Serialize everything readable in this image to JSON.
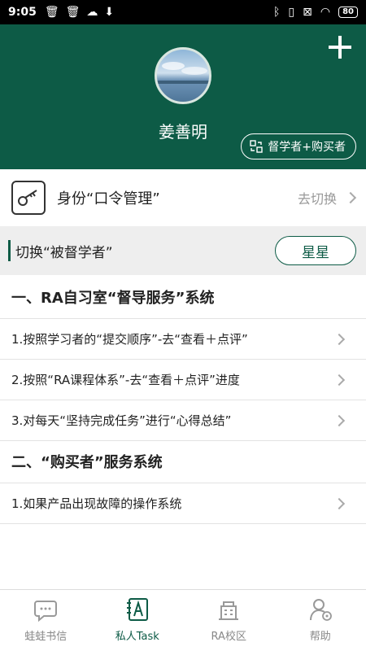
{
  "status_bar": {
    "time": "9:05",
    "battery": "80"
  },
  "header": {
    "user_name": "姜善明",
    "role_button_label": "督学者+购买者",
    "accent_color": "#0d5b46"
  },
  "identity": {
    "label": "身份“口令管理”",
    "action": "去切换"
  },
  "switch": {
    "label": "切换“被督学者”",
    "button_label": "星星"
  },
  "sections": [
    {
      "title": "一、RA自习室“督导服务”系统",
      "items": [
        "1.按照学习者的“提交顺序”-去“查看＋点评”",
        "2.按照“RA课程体系”-去“查看＋点评”进度",
        "3.对每天“坚持完成任务”进行“心得总结”"
      ]
    },
    {
      "title": "二、“购买者”服务系统",
      "items": [
        "1.如果产品出现故障的操作系统"
      ]
    }
  ],
  "bottom_nav": [
    {
      "label": "蛙蛙书信",
      "icon": "chat-bubble-icon",
      "active": false
    },
    {
      "label": "私人Task",
      "icon": "task-book-icon",
      "active": true
    },
    {
      "label": "RA校区",
      "icon": "building-icon",
      "active": false
    },
    {
      "label": "帮助",
      "icon": "help-person-icon",
      "active": false
    }
  ]
}
